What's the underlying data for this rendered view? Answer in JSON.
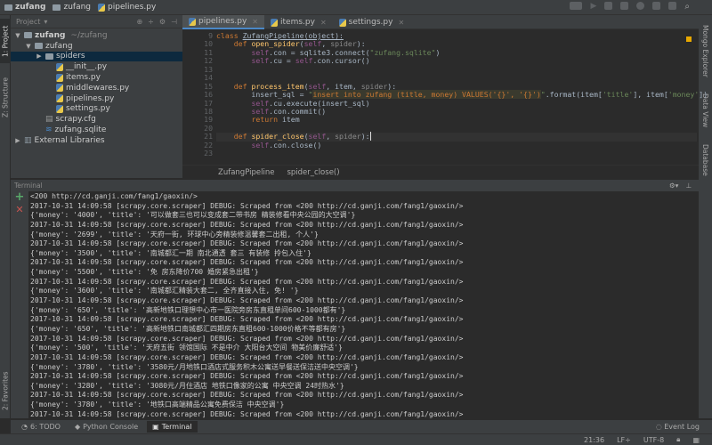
{
  "nav": {
    "crumbs": [
      "zufang",
      "zufang",
      "pipelines.py"
    ]
  },
  "left_strip": {
    "project": "1: Project",
    "structure": "Z: Structure",
    "favorites": "2: Favorites"
  },
  "right_strip": {
    "mongo": "Mongo Explorer",
    "dataview": "Data View",
    "database": "Database"
  },
  "project": {
    "header": "Project",
    "items": [
      {
        "label": "zufang",
        "extra": "~/zufang",
        "depth": 0,
        "arrow": "▼",
        "icon": "folder"
      },
      {
        "label": "zufang",
        "depth": 1,
        "arrow": "▼",
        "icon": "folder"
      },
      {
        "label": "spiders",
        "depth": 2,
        "arrow": "▶",
        "icon": "folder",
        "selected": true
      },
      {
        "label": "__init__.py",
        "depth": 3,
        "icon": "python"
      },
      {
        "label": "items.py",
        "depth": 3,
        "icon": "python"
      },
      {
        "label": "middlewares.py",
        "depth": 3,
        "icon": "python"
      },
      {
        "label": "pipelines.py",
        "depth": 3,
        "icon": "python"
      },
      {
        "label": "settings.py",
        "depth": 3,
        "icon": "python"
      },
      {
        "label": "scrapy.cfg",
        "depth": 2,
        "icon": "file"
      },
      {
        "label": "zufang.sqlite",
        "depth": 2,
        "icon": "database"
      },
      {
        "label": "External Libraries",
        "depth": 0,
        "arrow": "▶",
        "icon": "library"
      }
    ]
  },
  "tabs": [
    {
      "label": "pipelines.py",
      "active": true
    },
    {
      "label": "items.py"
    },
    {
      "label": "settings.py"
    }
  ],
  "editor": {
    "lines": [
      {
        "n": "9",
        "t": [
          [
            "class ",
            "kw"
          ],
          [
            "ZufangPipeline(object):",
            "cls"
          ]
        ]
      },
      {
        "n": "10",
        "t": [
          [
            "    def ",
            "kw"
          ],
          [
            "open_spider",
            "fn"
          ],
          [
            "(",
            ""
          ],
          [
            "self",
            "self"
          ],
          [
            ", ",
            ""
          ],
          [
            "spider",
            "param"
          ],
          [
            "):",
            ""
          ]
        ]
      },
      {
        "n": "11",
        "t": [
          [
            "        ",
            ""
          ],
          [
            "self",
            "self"
          ],
          [
            ".con = sqlite3.connect(",
            ""
          ],
          [
            "\"zufang.sqlite\"",
            "str"
          ],
          [
            ")",
            ""
          ]
        ]
      },
      {
        "n": "12",
        "t": [
          [
            "        ",
            ""
          ],
          [
            "self",
            "self"
          ],
          [
            ".cu = ",
            ""
          ],
          [
            "self",
            "self"
          ],
          [
            ".con.cursor()",
            ""
          ]
        ]
      },
      {
        "n": "13",
        "t": []
      },
      {
        "n": "14",
        "t": []
      },
      {
        "n": "15",
        "t": [
          [
            "    def ",
            "kw"
          ],
          [
            "process_item",
            "fn"
          ],
          [
            "(",
            ""
          ],
          [
            "self",
            "self"
          ],
          [
            ", item, ",
            ""
          ],
          [
            "spider",
            "param"
          ],
          [
            "):",
            ""
          ]
        ]
      },
      {
        "n": "16",
        "t": [
          [
            "        insert_sql = ",
            ""
          ],
          [
            "\"",
            "str"
          ],
          [
            "insert into zufang (title, money) VALUES('{}', '{}')",
            "sqlbg"
          ],
          [
            "\"",
            "str"
          ],
          [
            ".format(item[",
            ""
          ],
          [
            "'title'",
            "str"
          ],
          [
            "], item[",
            ""
          ],
          [
            "'money'",
            "str"
          ],
          [
            "])",
            ""
          ]
        ]
      },
      {
        "n": "17",
        "t": [
          [
            "        ",
            ""
          ],
          [
            "self",
            "self"
          ],
          [
            ".cu.execute(insert_sql)",
            ""
          ]
        ]
      },
      {
        "n": "18",
        "t": [
          [
            "        ",
            ""
          ],
          [
            "self",
            "self"
          ],
          [
            ".con.commit()",
            ""
          ]
        ]
      },
      {
        "n": "19",
        "t": [
          [
            "        ",
            ""
          ],
          [
            "return ",
            "kw"
          ],
          [
            "item",
            ""
          ]
        ]
      },
      {
        "n": "20",
        "t": []
      },
      {
        "n": "21",
        "t": [
          [
            "    def ",
            "kw"
          ],
          [
            "spider_close",
            "fn"
          ],
          [
            "(",
            ""
          ],
          [
            "self",
            "self"
          ],
          [
            ", ",
            ""
          ],
          [
            "spider",
            "param"
          ],
          [
            "):",
            ""
          ]
        ],
        "current": true
      },
      {
        "n": "22",
        "t": [
          [
            "        ",
            ""
          ],
          [
            "self",
            "self"
          ],
          [
            ".con.close()",
            ""
          ]
        ]
      },
      {
        "n": "23",
        "t": []
      }
    ]
  },
  "breadcrumb": [
    "ZufangPipeline",
    "spider_close()"
  ],
  "terminal": {
    "title": "Terminal",
    "lines": [
      "<200 http://cd.ganji.com/fang1/gaoxin/>",
      "2017-10-31 14:09:58 [scrapy.core.scraper] DEBUG: Scraped from <200 http://cd.ganji.com/fang1/gaoxin/>",
      "{'money': '4000', 'title': '可以做套三也可以变成套二带书房 精装修看中央公园的大空调'}",
      "2017-10-31 14:09:58 [scrapy.core.scraper] DEBUG: Scraped from <200 http://cd.ganji.com/fang1/gaoxin/>",
      "{'money': '2699', 'title': '天府一街, 环球中心旁精装修温馨套二出租, 个人'}",
      "2017-10-31 14:09:58 [scrapy.core.scraper] DEBUG: Scraped from <200 http://cd.ganji.com/fang1/gaoxin/>",
      "{'money': '3500', 'title': '南城都汇一期 南北通透 套三 有装修 拎包入住'}",
      "2017-10-31 14:09:58 [scrapy.core.scraper] DEBUG: Scraped from <200 http://cd.ganji.com/fang1/gaoxin/>",
      "{'money': '5500', 'title': '免 房东降价700 婚房紧急出租'}",
      "2017-10-31 14:09:58 [scrapy.core.scraper] DEBUG: Scraped from <200 http://cd.ganji.com/fang1/gaoxin/>",
      "{'money': '3600', 'title': '南城都汇精装大套二, 全齐直接入住, 免! '}",
      "2017-10-31 14:09:58 [scrapy.core.scraper] DEBUG: Scraped from <200 http://cd.ganji.com/fang1/gaoxin/>",
      "{'money': '650', 'title': '高新地铁口理想中心市一医院旁房东直租单间600-1000都有'}",
      "2017-10-31 14:09:58 [scrapy.core.scraper] DEBUG: Scraped from <200 http://cd.ganji.com/fang1/gaoxin/>",
      "{'money': '650', 'title': '高新地铁口南城都汇四期房东直租600-1000价格不等都有房'}",
      "2017-10-31 14:09:58 [scrapy.core.scraper] DEBUG: Scraped from <200 http://cd.ganji.com/fang1/gaoxin/>",
      "{'money': '500', 'title': '天府五街 领馆国际 不是中介 大阳台大空间 物美价廉舒适'}",
      "2017-10-31 14:09:58 [scrapy.core.scraper] DEBUG: Scraped from <200 http://cd.ganji.com/fang1/gaoxin/>",
      "{'money': '3780', 'title': '3580元/月地铁口酒店式服务积木公寓送早餐送保洁送中央空调'}",
      "2017-10-31 14:09:58 [scrapy.core.scraper] DEBUG: Scraped from <200 http://cd.ganji.com/fang1/gaoxin/>",
      "{'money': '3280', 'title': '3080元/月住酒店 地铁口像家的公寓 中央空调 24时热水'}",
      "2017-10-31 14:09:58 [scrapy.core.scraper] DEBUG: Scraped from <200 http://cd.ganji.com/fang1/gaoxin/>",
      "{'money': '3780', 'title': '地铁口高端精品公寓免费保洁 中央空调'}",
      "2017-10-31 14:09:58 [scrapy.core.scraper] DEBUG: Scraped from <200 http://cd.ganji.com/fang1/gaoxin/>"
    ]
  },
  "bottom_tabs": [
    {
      "label": "6: TODO"
    },
    {
      "label": "Python Console"
    },
    {
      "label": "Terminal",
      "active": true
    }
  ],
  "event_log": "Event Log",
  "status": {
    "position": "21:36",
    "line_sep": "LF÷",
    "encoding": "UTF-8"
  },
  "colors": {
    "accent": "#4a88c7",
    "background": "#2b2b2b",
    "panel": "#3c3f41",
    "selection": "#0d293e"
  }
}
